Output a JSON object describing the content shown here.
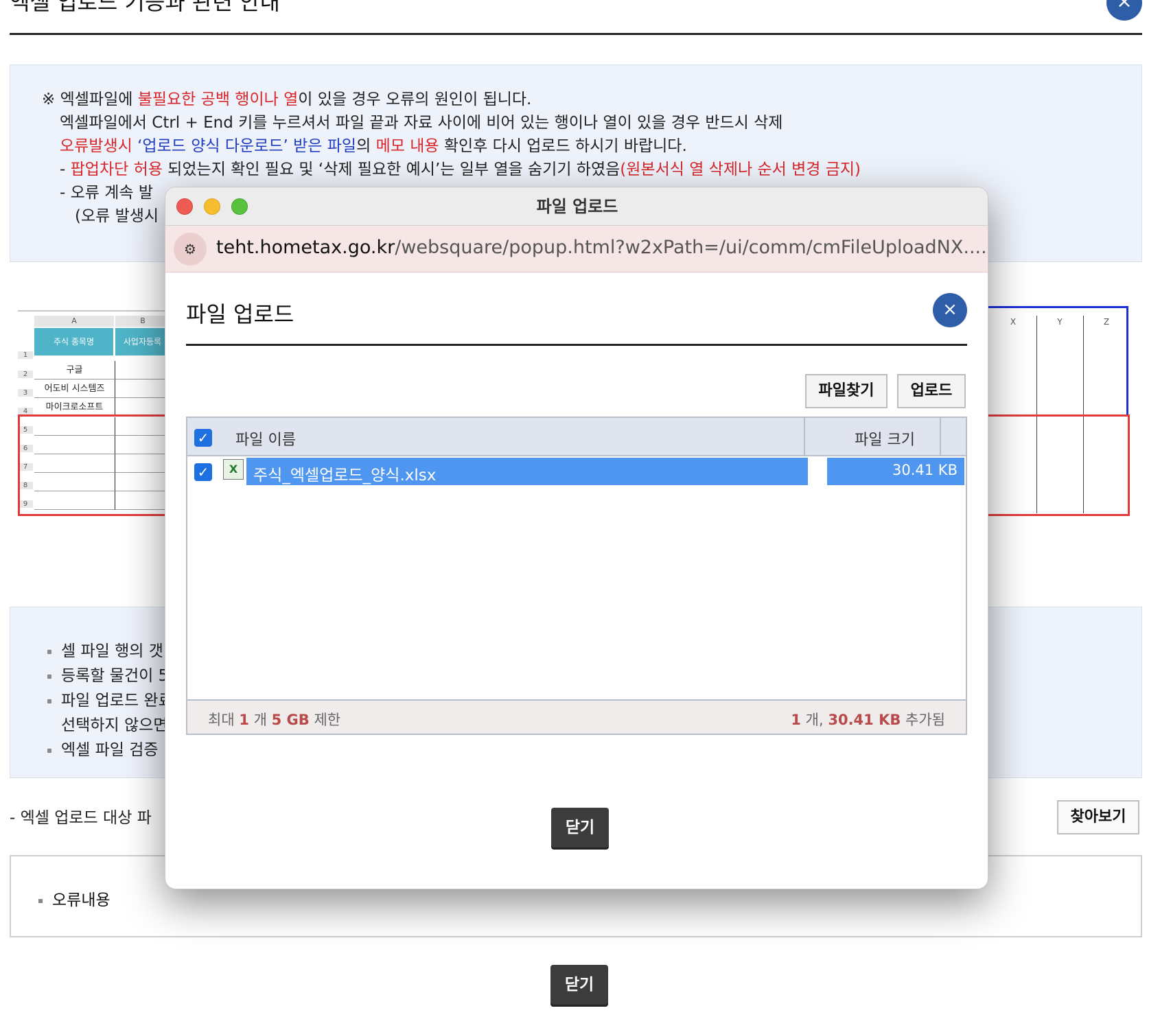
{
  "page": {
    "title": "엑셀 업로드 기능과 관련 안내",
    "close_icon": "×",
    "notice": {
      "l1_prefix": "※ 엑셀파일에 ",
      "l1_red": "불필요한 공백 행이나 열",
      "l1_suffix": "이 있을 경우 오류의 원인이 됩니다.",
      "l2": "엑셀파일에서 Ctrl + End 키를 누르셔서 파일 끝과 자료 사이에 비어 있는 행이나 열이 있을 경우 반드시 삭제",
      "l3_red1": "오류발생시 ",
      "l3_blue": "‘업로드 양식 다운로드’ 받은 파일",
      "l3_mid": "의 ",
      "l3_red2": "메모 내용",
      "l3_suffix": " 확인후 다시 업로드 하시기 바랍니다.",
      "l4_prefix": "- ",
      "l4_red1": "팝업차단 허용",
      "l4_mid": " 되었는지 확인 필요 및 ‘삭제 필요한 예시’는 일부 열을 숨기기 하였음",
      "l4_red2": "(원본서식 열 삭제나 순서 변경 금지)",
      "l5": "- 오류 계속 발",
      "l6": "(오류 발생시"
    },
    "sheet_left": {
      "col_a": "A",
      "col_b": "B",
      "header_1": "주식 종목명",
      "header_2": "사업자등록",
      "rows": [
        "구글",
        "어도비 시스템즈",
        "마이크로소프트"
      ],
      "row_numbers": [
        "1",
        "2",
        "3",
        "4",
        "5",
        "6",
        "7",
        "8",
        "9"
      ]
    },
    "sheet_right": {
      "cols": [
        "X",
        "Y",
        "Z"
      ]
    },
    "info": {
      "b1": "셀 파일 행의 갯",
      "b2": "등록할 물건이 5",
      "b3": "파일 업로드 완료",
      "b3_cont": "선택하지 않으면",
      "b4": "엑셀 파일 검증"
    },
    "target_label": "- 엑셀 업로드 대상 파",
    "browse_button": "찾아보기",
    "error_label": "오류내용",
    "close_button": "닫기"
  },
  "popup": {
    "window_title": "파일 업로드",
    "url_icon": "⚙",
    "url_host": "teht.hometax.go.kr",
    "url_path": "/websquare/popup.html?w2xPath=/ui/comm/cmFileUploadNX....",
    "dialog_title": "파일 업로드",
    "close_icon": "×",
    "find_button": "파일찾기",
    "upload_button": "업로드",
    "grid": {
      "col_name": "파일 이름",
      "col_size": "파일 크기",
      "rows": [
        {
          "name": "주식_엑셀업로드_양식.xlsx",
          "size": "30.41 KB",
          "checked": true
        }
      ]
    },
    "footer": {
      "limit_prefix": "최대 ",
      "limit_count": "1",
      "limit_mid": " 개 ",
      "limit_size": "5 GB",
      "limit_suffix": " 제한",
      "added_count": "1",
      "added_mid": " 개, ",
      "added_size": "30.41 KB",
      "added_suffix": " 추가됨"
    },
    "close_button": "닫기"
  },
  "colors": {
    "accent_blue": "#2f5ea8",
    "selection_blue": "#4f96f0",
    "warning_red": "#d8262a",
    "link_blue": "#1f3bc2"
  }
}
